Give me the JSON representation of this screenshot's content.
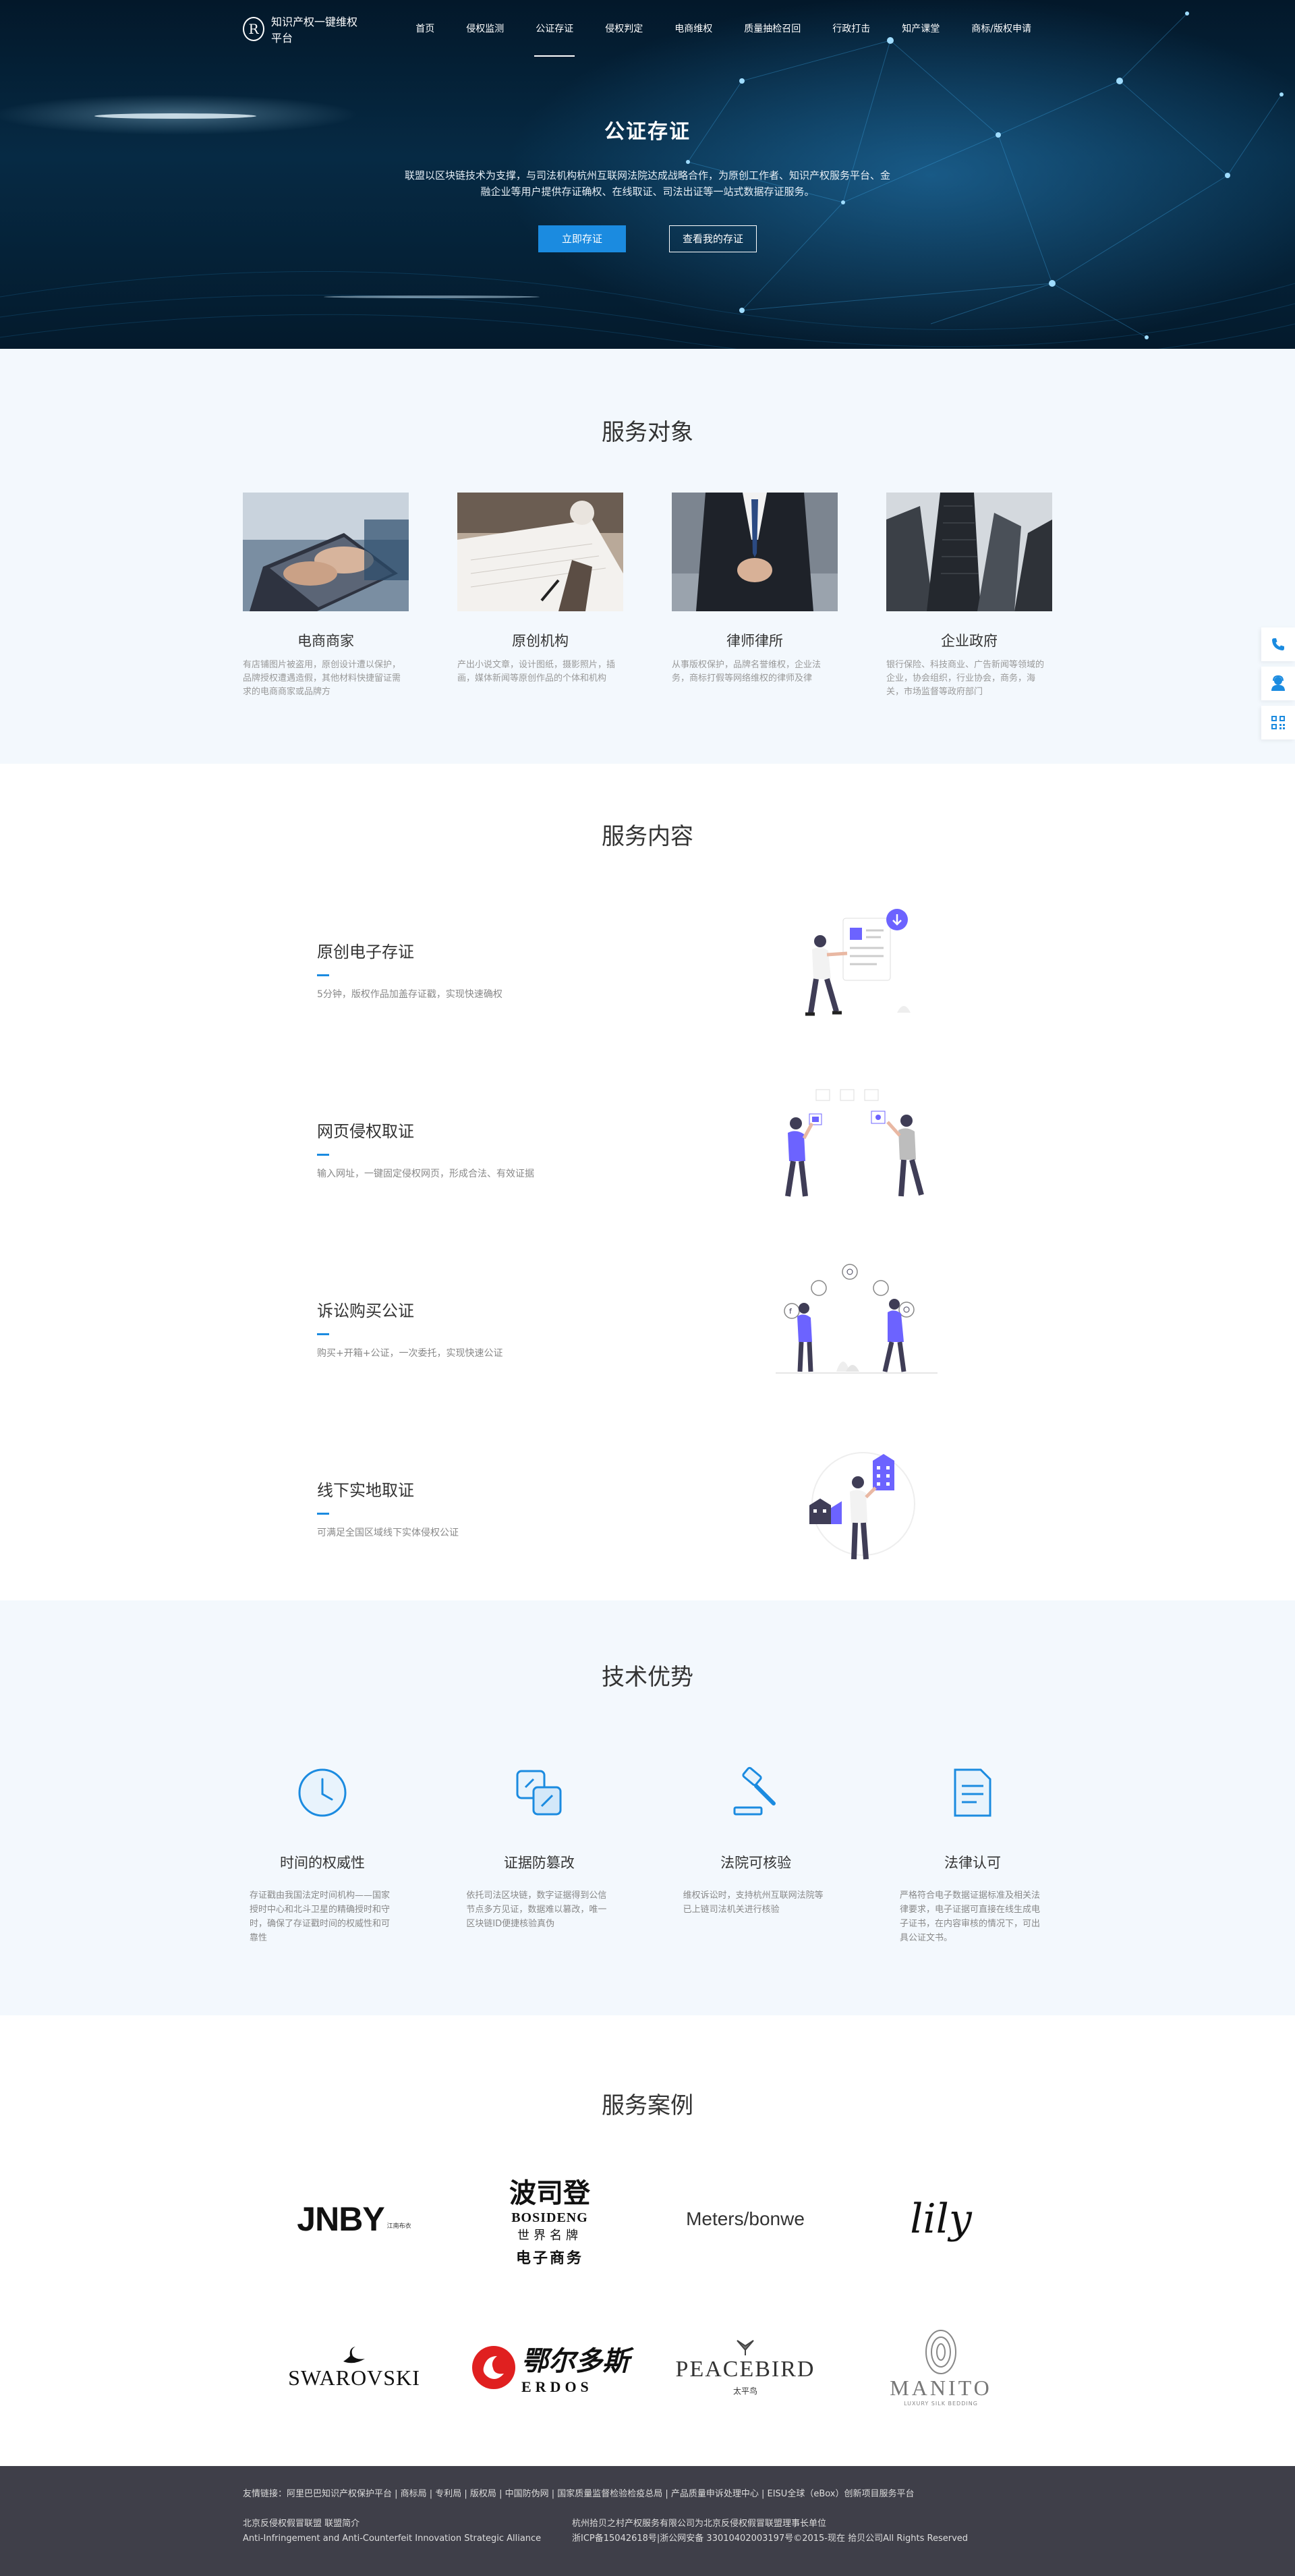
{
  "header": {
    "logo_mark": "R",
    "logo_text": "知识产权一键维权平台",
    "nav": [
      {
        "label": "首页"
      },
      {
        "label": "侵权监测"
      },
      {
        "label": "公证存证"
      },
      {
        "label": "侵权判定"
      },
      {
        "label": "电商维权"
      },
      {
        "label": "质量抽检召回"
      },
      {
        "label": "行政打击"
      },
      {
        "label": "知产课堂"
      },
      {
        "label": "商标/版权申请"
      }
    ],
    "active_index": 2
  },
  "hero": {
    "title": "公证存证",
    "desc": "联盟以区块链技术为支撑，与司法机构杭州互联网法院达成战略合作，为原创工作者、知识产权服务平台、金融企业等用户提供存证确权、在线取证、司法出证等一站式数据存证服务。",
    "primary_button": "立即存证",
    "secondary_button": "查看我的存证"
  },
  "service_objects": {
    "title": "服务对象",
    "items": [
      {
        "name": "电商商家",
        "desc": "有店铺图片被盗用，原创设计遭以保护，品牌授权遭遇造假，其他材料快捷留证需求的电商商家或品牌方",
        "icon": "laptop-typing-photo"
      },
      {
        "name": "原创机构",
        "desc": "产出小说文章，设计图纸，摄影照片，插画，媒体新闻等原创作品的个体和机构",
        "icon": "writing-hand-photo"
      },
      {
        "name": "律师律所",
        "desc": "从事版权保护，品牌名誉维权，企业法务，商标打假等网络维权的律师及律",
        "icon": "businessman-suit-photo"
      },
      {
        "name": "企业政府",
        "desc": "银行保险、科技商业、广告新闻等领域的企业，协会组织，行业协会，商务，海关，市场监督等政府部门",
        "icon": "skyscrapers-photo"
      }
    ]
  },
  "service_content": {
    "title": "服务内容",
    "items": [
      {
        "title": "原创电子存证",
        "desc": "5分钟，版权作品加盖存证戳，实现快速确权",
        "icon": "document-upload-illustration"
      },
      {
        "title": "网页侵权取证",
        "desc": "输入网址，一键固定侵权网页，形成合法、有效证据",
        "icon": "two-people-sharing-illustration"
      },
      {
        "title": "诉讼购买公证",
        "desc": "购买+开箱+公证，一次委托，实现快速公证",
        "icon": "social-media-illustration"
      },
      {
        "title": "线下实地取证",
        "desc": "可满足全国区域线下实体侵权公证",
        "icon": "buildings-illustration"
      }
    ]
  },
  "tech": {
    "title": "技术优势",
    "items": [
      {
        "name": "时间的权威性",
        "desc": "存证戳由我国法定时间机构——国家授时中心和北斗卫星的精确授时和守时，确保了存证戳时间的权威性和可靠性",
        "icon": "clock-icon"
      },
      {
        "name": "证据防篡改",
        "desc": "依托司法区块链，数字证据得到公信节点多方见证，数据难以篡改，唯一区块链ID便捷核验真伪",
        "icon": "layers-icon"
      },
      {
        "name": "法院可核验",
        "desc": "维权诉讼时，支持杭州互联网法院等已上链司法机关进行核验",
        "icon": "gavel-icon"
      },
      {
        "name": "法律认可",
        "desc": "严格符合电子数据证据标准及相关法律要求，电子证据可直接在线生成电子证书，在内容审核的情况下，可出具公证文书。",
        "icon": "document-icon"
      }
    ]
  },
  "cases": {
    "title": "服务案例",
    "logos": [
      {
        "name": "JNBY",
        "sub": "江南布衣"
      },
      {
        "name": "BOSIDENG",
        "cn_top": "波司登",
        "cn_mid": "世界名牌",
        "cn_bot": "电子商务"
      },
      {
        "name": "Meters/bonwe"
      },
      {
        "name": "lily"
      },
      {
        "name": "SWAROVSKI"
      },
      {
        "name": "ERDOS",
        "cn": "鄂尔多斯"
      },
      {
        "name": "PEACEBIRD",
        "cn": "太平鸟"
      },
      {
        "name": "MANITO",
        "sub": "LUXURY SILK BEDDING"
      }
    ]
  },
  "footer": {
    "links": "友情链接：阿里巴巴知识产权保护平台 | 商标局 | 专利局 | 版权局 | 中国防伪网 | 国家质量监督检验检疫总局 | 产品质量申诉处理中心 | EISU全球（eBox）创新项目服务平台",
    "org_cn": "北京反侵权假冒联盟 联盟简介",
    "org_en": "Anti-Infringement and Anti-Counterfeit Innovation Strategic Alliance",
    "company": "杭州拾贝之村产权服务有限公司为北京反侵权假冒联盟理事长单位",
    "icp": "浙ICP备15042618号|浙公网安备 33010402003197号©2015-现在 拾贝公司All Rights Reserved"
  },
  "sidebar": [
    "phone-icon",
    "support-agent-icon",
    "qrcode-icon"
  ],
  "colors": {
    "accent": "#1b8be0",
    "illus_purple": "#6c63ff",
    "footer_bg": "#3f3f49",
    "section_bg": "#f3f8fd"
  }
}
